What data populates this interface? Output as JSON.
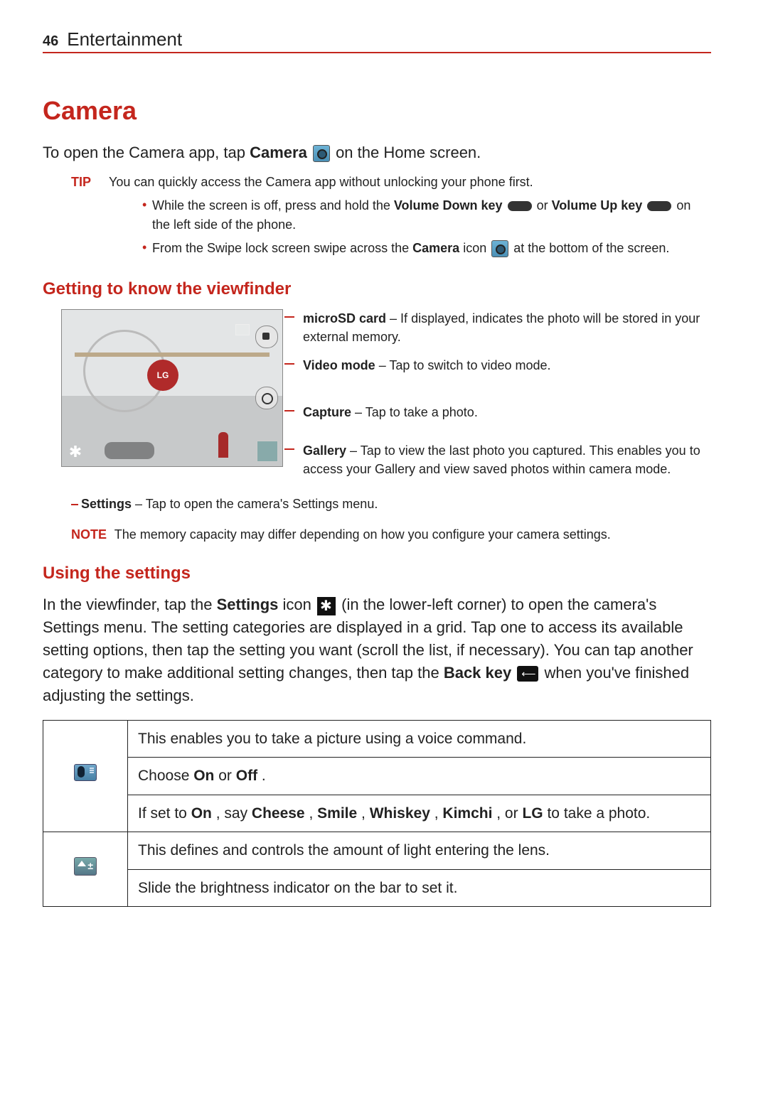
{
  "header": {
    "page_number": "46",
    "chapter_title": "Entertainment"
  },
  "section": {
    "title": "Camera",
    "intro_pre": "To open the Camera app, tap ",
    "intro_bold": "Camera",
    "intro_post": " on the Home screen."
  },
  "tip": {
    "label": "TIP",
    "lead": "You can quickly access the Camera app without unlocking your phone first.",
    "bullets": [
      {
        "pre": "While the screen is off, press and hold the ",
        "b1": "Volume Down key",
        "mid": " or ",
        "b2": "Volume Up key",
        "post": " on the left side of the phone."
      },
      {
        "pre": "From the Swipe lock screen swipe across the ",
        "b1": "Camera",
        "mid": " icon ",
        "post": " at the bottom of the screen."
      }
    ]
  },
  "viewfinder": {
    "heading": "Getting to know the viewfinder",
    "lg_logo": "LG",
    "callouts": {
      "sd_title": "microSD card",
      "sd_text": " – If displayed, indicates the photo will be stored in your external memory.",
      "video_title": "Video mode",
      "video_text": " – Tap to switch to video mode.",
      "capture_title": "Capture",
      "capture_text": " – Tap to take a photo.",
      "gallery_title": "Gallery",
      "gallery_text": " – Tap to view the last photo you captured. This enables you to access your Gallery and view saved photos within camera mode.",
      "settings_title": "Settings",
      "settings_text": " – Tap to open the camera's Settings menu."
    }
  },
  "note": {
    "label": "NOTE",
    "text": "The memory capacity may differ depending on how you configure your camera settings."
  },
  "using_settings": {
    "heading": "Using the settings",
    "para_pre": "In the viewfinder, tap the ",
    "para_b1": "Settings",
    "para_mid1": " icon ",
    "para_mid2": " (in the lower-left corner) to open the camera's Settings menu. The setting categories are displayed in a grid. Tap one to access its available setting options, then tap the setting you want (scroll the list, if necessary). You can tap another category to make additional setting changes, then tap the ",
    "para_b2": "Back key",
    "para_post": " when you've finished adjusting the settings."
  },
  "settings_table": {
    "rows": [
      {
        "icon": "voice-shutter-icon",
        "line1_pre": "This enables you to take a picture using a voice command.",
        "line2_pre": "Choose ",
        "line2_b1": "On",
        "line2_mid": " or ",
        "line2_b2": "Off",
        "line2_post": ".",
        "line3_pre": "If set to ",
        "line3_b1": "On",
        "line3_mid1": ", say ",
        "line3_b2": "Cheese",
        "line3_c1": ", ",
        "line3_b3": "Smile",
        "line3_c2": ", ",
        "line3_b4": "Whiskey",
        "line3_c3": ", ",
        "line3_b5": "Kimchi",
        "line3_c4": ", or ",
        "line3_b6": "LG",
        "line3_post": " to take a photo."
      },
      {
        "icon": "exposure-icon",
        "line1": "This defines and controls the amount of light entering the lens.",
        "line2": "Slide the brightness indicator on the bar to set it."
      }
    ]
  }
}
